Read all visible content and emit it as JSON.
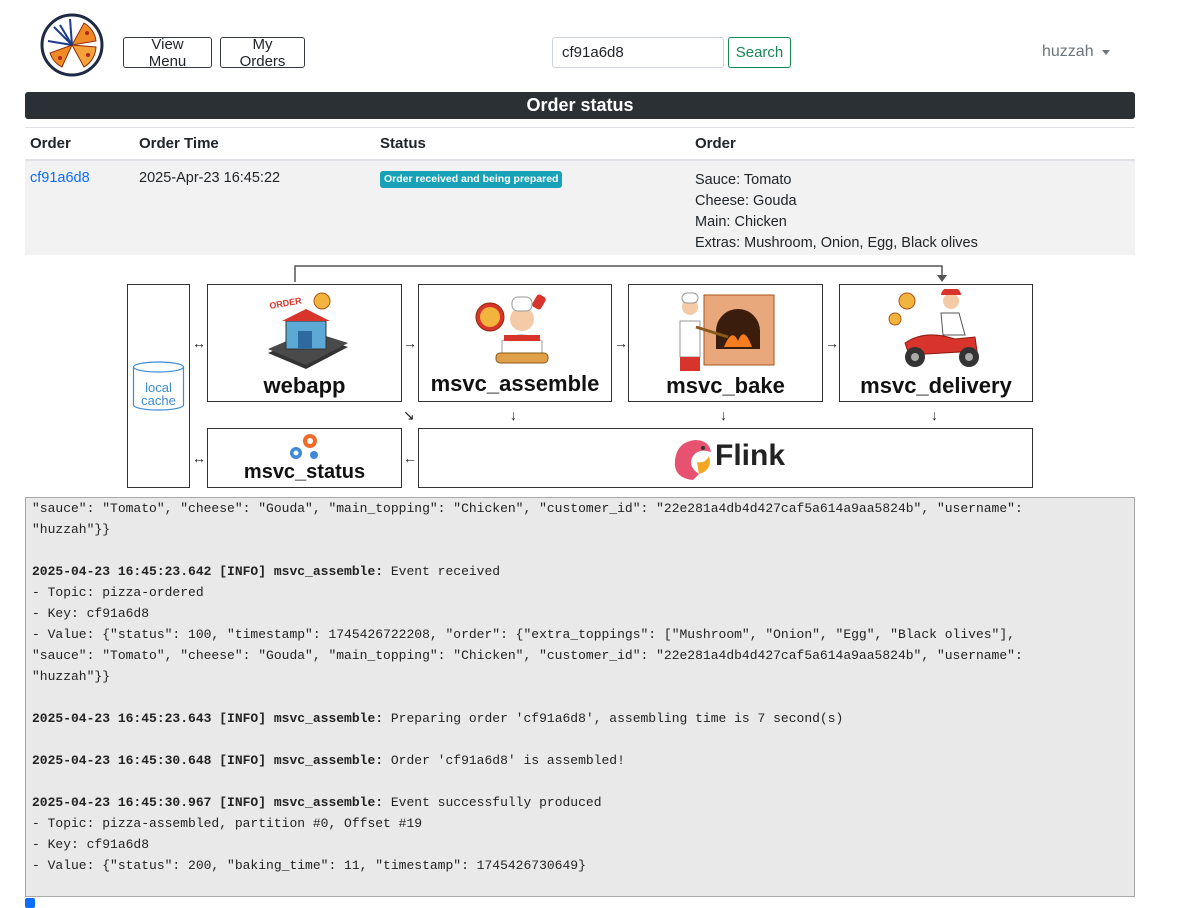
{
  "header": {
    "view_menu_label": "View Menu",
    "my_orders_label": "My Orders",
    "search_value": "cf91a6d8",
    "search_label": "Search",
    "username": "huzzah"
  },
  "title": "Order status",
  "table": {
    "headers": [
      "Order",
      "Order Time",
      "Status",
      "Order"
    ],
    "row": {
      "order_id": "cf91a6d8",
      "order_time": "2025-Apr-23 16:45:22",
      "status": "Order received and being prepared",
      "details": [
        "Sauce: Tomato",
        "Cheese: Gouda",
        "Main: Chicken",
        "Extras: Mushroom, Onion, Egg, Black olives"
      ]
    }
  },
  "diagram": {
    "cache_label_1": "local",
    "cache_label_2": "cache",
    "webapp": "webapp",
    "assemble": "msvc_assemble",
    "bake": "msvc_bake",
    "delivery": "msvc_delivery",
    "status": "msvc_status",
    "flink": "Flink",
    "arrows": {
      "bi": "↔",
      "right": "→",
      "down": "↓",
      "left": "←",
      "diag": "↘"
    }
  },
  "log": {
    "lines": [
      {
        "text": "\"sauce\": \"Tomato\", \"cheese\": \"Gouda\", \"main_topping\": \"Chicken\", \"customer_id\": \"22e281a4db4d427caf5a614a9aa5824b\", \"username\":"
      },
      {
        "text": "\"huzzah\"}}"
      },
      {
        "gap": true
      },
      {
        "bold": "2025-04-23 16:45:23.642 [INFO] msvc_assemble:",
        "text": " Event received"
      },
      {
        "text": "- Topic: pizza-ordered"
      },
      {
        "text": "- Key: cf91a6d8"
      },
      {
        "text": "- Value: {\"status\": 100, \"timestamp\": 1745426722208, \"order\": {\"extra_toppings\": [\"Mushroom\", \"Onion\", \"Egg\", \"Black olives\"],"
      },
      {
        "text": "\"sauce\": \"Tomato\", \"cheese\": \"Gouda\", \"main_topping\": \"Chicken\", \"customer_id\": \"22e281a4db4d427caf5a614a9aa5824b\", \"username\":"
      },
      {
        "text": "\"huzzah\"}}"
      },
      {
        "gap": true
      },
      {
        "bold": "2025-04-23 16:45:23.643 [INFO] msvc_assemble:",
        "text": " Preparing order 'cf91a6d8', assembling time is 7 second(s)"
      },
      {
        "gap": true
      },
      {
        "bold": "2025-04-23 16:45:30.648 [INFO] msvc_assemble:",
        "text": " Order 'cf91a6d8' is assembled!"
      },
      {
        "gap": true
      },
      {
        "bold": "2025-04-23 16:45:30.967 [INFO] msvc_assemble:",
        "text": " Event successfully produced"
      },
      {
        "text": "- Topic: pizza-assembled, partition #0, Offset #19"
      },
      {
        "text": "- Key: cf91a6d8"
      },
      {
        "text": "- Value: {\"status\": 200, \"baking_time\": 11, \"timestamp\": 1745426730649}"
      }
    ]
  },
  "colors": {
    "primary": "#0d6efd",
    "success": "#198754",
    "info_badge": "#17a2b8",
    "title_bar": "#2b3035"
  }
}
